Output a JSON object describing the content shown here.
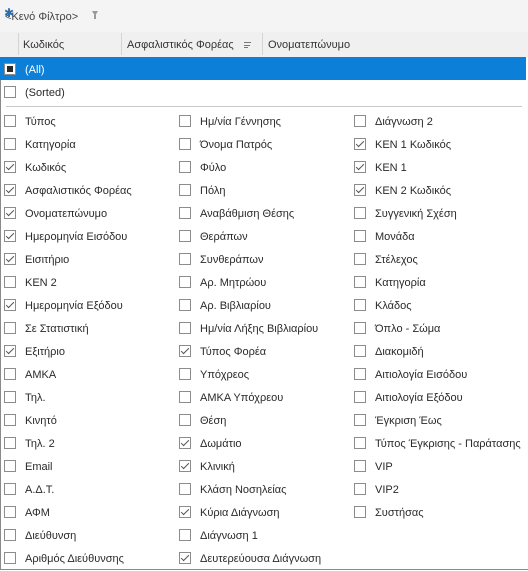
{
  "filter_bar": {
    "label": "<Κενό Φίλτρο>"
  },
  "columns": [
    "Κωδικός",
    "Ασφαλιστικός Φορέας",
    "Ονοματεπώνυμο"
  ],
  "all_item": {
    "label": "(All)",
    "state": "indeterminate"
  },
  "sorted_item": {
    "label": "(Sorted)",
    "checked": false
  },
  "column_chooser": [
    [
      {
        "label": "Τύπος",
        "checked": false
      },
      {
        "label": "Κατηγορία",
        "checked": false
      },
      {
        "label": "Κωδικός",
        "checked": true
      },
      {
        "label": "Ασφαλιστικός Φορέας",
        "checked": true
      },
      {
        "label": "Ονοματεπώνυμο",
        "checked": true
      },
      {
        "label": "Ημερομηνία Εισόδου",
        "checked": true
      },
      {
        "label": "Εισιτήριο",
        "checked": true
      },
      {
        "label": "ΚΕΝ 2",
        "checked": false
      },
      {
        "label": "Ημερομηνία Εξόδου",
        "checked": true
      },
      {
        "label": "Σε Στατιστική",
        "checked": false
      },
      {
        "label": "Εξιτήριο",
        "checked": true
      },
      {
        "label": "ΑΜΚΑ",
        "checked": false
      },
      {
        "label": "Τηλ.",
        "checked": false
      },
      {
        "label": "Κινητό",
        "checked": false
      },
      {
        "label": "Τηλ. 2",
        "checked": false
      },
      {
        "label": "Email",
        "checked": false
      },
      {
        "label": "Α.Δ.Τ.",
        "checked": false
      },
      {
        "label": "ΑΦΜ",
        "checked": false
      },
      {
        "label": "Διεύθυνση",
        "checked": false
      },
      {
        "label": "Αριθμός Διεύθυνσης",
        "checked": false
      }
    ],
    [
      {
        "label": "Ημ/νία Γέννησης",
        "checked": false
      },
      {
        "label": "Όνομα Πατρός",
        "checked": false
      },
      {
        "label": "Φύλο",
        "checked": false
      },
      {
        "label": "Πόλη",
        "checked": false
      },
      {
        "label": "Αναβάθμιση Θέσης",
        "checked": false
      },
      {
        "label": "Θεράπων",
        "checked": false
      },
      {
        "label": "Συνθεράπων",
        "checked": false
      },
      {
        "label": "Αρ. Μητρώου",
        "checked": false
      },
      {
        "label": "Αρ. Βιβλιαρίου",
        "checked": false
      },
      {
        "label": "Ημ/νία Λήξης Βιβλιαρίου",
        "checked": false
      },
      {
        "label": "Τύπος Φορέα",
        "checked": true
      },
      {
        "label": "Υπόχρεος",
        "checked": false
      },
      {
        "label": "ΑΜΚΑ Υπόχρεου",
        "checked": false
      },
      {
        "label": "Θέση",
        "checked": false
      },
      {
        "label": "Δωμάτιο",
        "checked": true
      },
      {
        "label": "Κλινική",
        "checked": true
      },
      {
        "label": "Κλάση Νοσηλείας",
        "checked": false
      },
      {
        "label": "Κύρια Διάγνωση",
        "checked": true
      },
      {
        "label": "Διάγνωση 1",
        "checked": false
      },
      {
        "label": "Δευτερεύουσα Διάγνωση",
        "checked": true
      }
    ],
    [
      {
        "label": "Διάγνωση 2",
        "checked": false
      },
      {
        "label": "ΚΕΝ 1 Κωδικός",
        "checked": true
      },
      {
        "label": "ΚΕΝ 1",
        "checked": true
      },
      {
        "label": "ΚΕΝ 2 Κωδικός",
        "checked": true
      },
      {
        "label": "Συγγενική Σχέση",
        "checked": false
      },
      {
        "label": "Μονάδα",
        "checked": false
      },
      {
        "label": "Στέλεχος",
        "checked": false
      },
      {
        "label": "Κατηγορία",
        "checked": false
      },
      {
        "label": "Κλάδος",
        "checked": false
      },
      {
        "label": "Όπλο - Σώμα",
        "checked": false
      },
      {
        "label": "Διακομιδή",
        "checked": false
      },
      {
        "label": "Αιτιολογία Εισόδου",
        "checked": false
      },
      {
        "label": "Αιτιολογία Εξόδου",
        "checked": false
      },
      {
        "label": "Έγκριση Έως",
        "checked": false
      },
      {
        "label": "Τύπος Έγκρισης - Παράτασης",
        "checked": false
      },
      {
        "label": "VIP",
        "checked": false
      },
      {
        "label": "VIP2",
        "checked": false
      },
      {
        "label": "Συστήσας",
        "checked": false
      }
    ]
  ],
  "colors": {
    "selection": "#0c7fd8",
    "header_bg": "#f0f0f0"
  },
  "icons": {
    "filter": "funnel-icon",
    "sort": "sort-lines-icon",
    "select": "asterisk-icon"
  }
}
